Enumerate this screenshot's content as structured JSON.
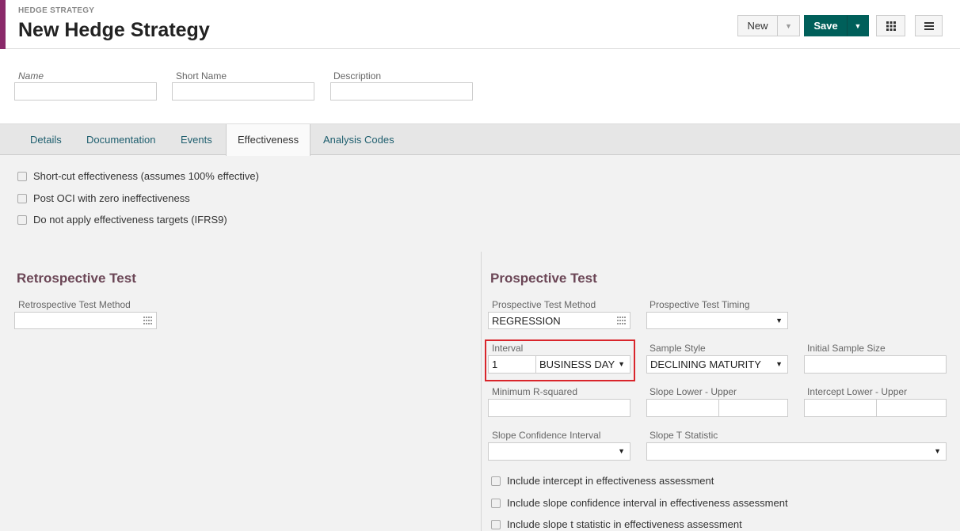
{
  "header": {
    "breadcrumb": "HEDGE STRATEGY",
    "title": "New Hedge Strategy",
    "new_label": "New",
    "save_label": "Save"
  },
  "topform": {
    "name_label": "Name",
    "short_name_label": "Short Name",
    "description_label": "Description"
  },
  "tabs": [
    {
      "label": "Details"
    },
    {
      "label": "Documentation"
    },
    {
      "label": "Events"
    },
    {
      "label": "Effectiveness",
      "active": true
    },
    {
      "label": "Analysis Codes"
    }
  ],
  "effectiveness_options": [
    "Short-cut effectiveness (assumes 100% effective)",
    "Post OCI with zero ineffectiveness",
    "Do not apply effectiveness targets (IFRS9)"
  ],
  "retrospective": {
    "title": "Retrospective Test",
    "method_label": "Retrospective Test Method",
    "method_value": ""
  },
  "prospective": {
    "title": "Prospective Test",
    "method_label": "Prospective Test Method",
    "method_value": "REGRESSION",
    "timing_label": "Prospective Test Timing",
    "interval_label": "Interval",
    "interval_value": "1",
    "interval_unit": "BUSINESS DAY",
    "sample_style_label": "Sample Style",
    "sample_style_value": "DECLINING MATURITY",
    "initial_sample_label": "Initial Sample Size",
    "min_r2_label": "Minimum R-squared",
    "slope_label": "Slope Lower - Upper",
    "intercept_label": "Intercept Lower - Upper",
    "slope_ci_label": "Slope Confidence Interval",
    "slope_t_label": "Slope T Statistic",
    "checks": [
      "Include intercept in effectiveness assessment",
      "Include slope confidence interval in effectiveness assessment",
      "Include slope t statistic in effectiveness assessment"
    ]
  },
  "colors": {
    "accent": "#8a2a6a",
    "save_button": "#005f5a",
    "section_title": "#6b4656",
    "highlight": "#d9252b"
  }
}
